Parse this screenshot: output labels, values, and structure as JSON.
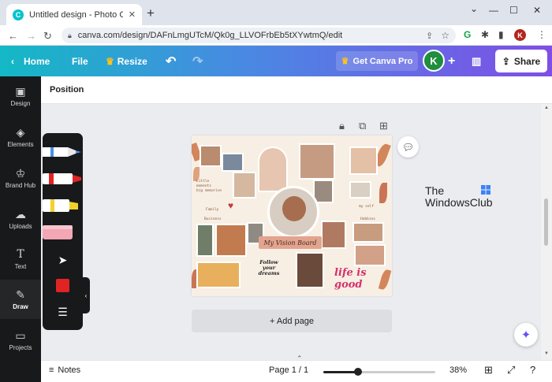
{
  "browser": {
    "tab_title": "Untitled design - Photo Collage",
    "tab_favicon": "C",
    "url": "canva.com/design/DAFnLmgUTcM/Qk0g_LLVOFrbEb5tXYwtmQ/edit",
    "profile_initial": "K"
  },
  "topbar": {
    "home": "Home",
    "file": "File",
    "resize": "Resize",
    "get_pro": "Get Canva Pro",
    "avatar_initial": "K",
    "share": "Share"
  },
  "leftnav": {
    "items": [
      {
        "label": "Design",
        "icon": "design-icon"
      },
      {
        "label": "Elements",
        "icon": "elements-icon"
      },
      {
        "label": "Brand Hub",
        "icon": "brand-hub-icon"
      },
      {
        "label": "Uploads",
        "icon": "uploads-icon"
      },
      {
        "label": "Text",
        "icon": "text-icon"
      },
      {
        "label": "Draw",
        "icon": "draw-icon",
        "active": true
      },
      {
        "label": "Projects",
        "icon": "projects-icon"
      }
    ]
  },
  "toolbar": {
    "position_label": "Position"
  },
  "draw_tools": {
    "pen_colors": [
      "#4a90e2",
      "#e02424",
      "#f2d12e"
    ],
    "selected_color": "#e02424"
  },
  "design": {
    "small_text": [
      "Little",
      "moments",
      "big memories"
    ],
    "family_label": "Family",
    "self_label": "my self",
    "business_label": "Business",
    "hobbies_label": "Hobbies",
    "banner_text": "My Vision Board",
    "life_text": "life is good",
    "follow_text": "Follow your dreams"
  },
  "watermark": {
    "line1": "The",
    "line2": "WindowsClub"
  },
  "add_page": "+ Add page",
  "bottombar": {
    "notes": "Notes",
    "page": "Page 1 / 1",
    "zoom": "38%",
    "zoom_fraction": 0.38
  },
  "colors": {
    "accent_purple": "#7f4ee6",
    "accent_teal": "#13b9c5",
    "sidebar_bg": "#18191b"
  }
}
